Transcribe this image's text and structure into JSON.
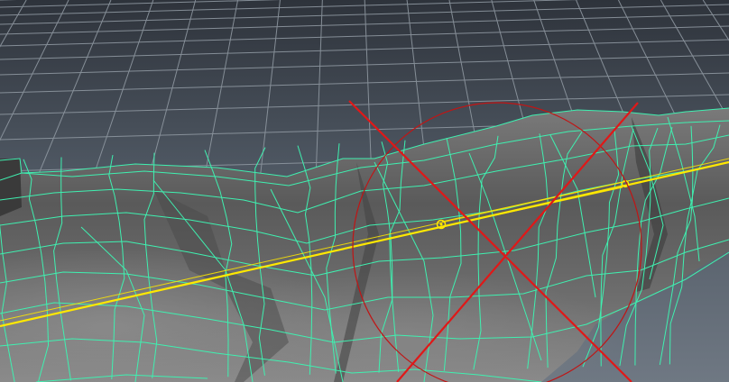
{
  "viewport": {
    "background_top": "#2e333b",
    "background_bottom": "#6f7883",
    "grid_color": "#8e97a0",
    "mesh_fill": "#5e5e5e",
    "mesh_wire_color": "#3ff0b0",
    "curve_color": "#ffe800",
    "manipulator_color": "#e01818",
    "manipulator_ring_color": "#c01515"
  },
  "icons": {
    "joint": "joint-icon",
    "manipulator": "rotate-manipulator-icon"
  }
}
